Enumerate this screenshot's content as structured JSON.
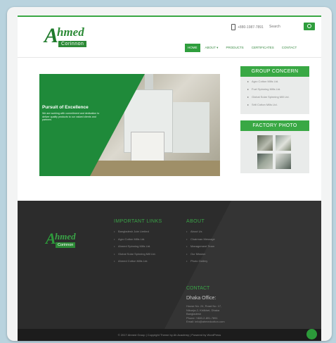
{
  "brand": {
    "logo_initial": "A",
    "logo_word": "hmed",
    "logo_sub": "Corinnon"
  },
  "header": {
    "phone": "+880-1987-7891",
    "search_placeholder": "Search",
    "nav": [
      "Home",
      "About ▾",
      "Products",
      "Certificates",
      "Contact"
    ],
    "active_nav": "Home"
  },
  "hero": {
    "title": "Pursuit of Excellence",
    "text": "We are working with commitment and dedication to deliver quality products to our valued clients and partners"
  },
  "sidebar": {
    "group_title": "GROUP CONCERN",
    "group_items": [
      "Agro Cotton Mills Ltd.",
      "Fuel Spinning Mills Ltd.",
      "Global Solar Spinning Mill Ltd.",
      "Sriti Cotton Mills Ltd."
    ],
    "factory_title": "FACTORY PHOTO"
  },
  "footer": {
    "links_title": "IMPORTANT LINKS",
    "links": [
      "Bangladesh Jute Limited",
      "Agro Cotton Mills Ltd.",
      "Ahmed Spinning Mills Ltd.",
      "Global Solar Spinning Mill Ltd.",
      "Ahmed Cotton Mills Ltd."
    ],
    "about_title": "ABOUT",
    "about_items": [
      "About Us",
      "Chairman Message",
      "Management Team",
      "Our Mission",
      "Photo Gallery"
    ],
    "contact_title": "CONTACT",
    "office_label": "Dhaka Office:",
    "office_lines": [
      "House No. 24, Road No. 17,",
      "Nikunja-2, Khilkhet, Dhaka",
      "Bangladesh",
      "Phone: +880-2-891-7891",
      "Email: info@ahmedcotton.com"
    ],
    "copyright": "© 2017 Ahmed Group | Copyright Theme by Ah Academy | Powered by WordPress"
  },
  "colors": {
    "accent": "#39a844",
    "dark": "#2c2c2c"
  }
}
